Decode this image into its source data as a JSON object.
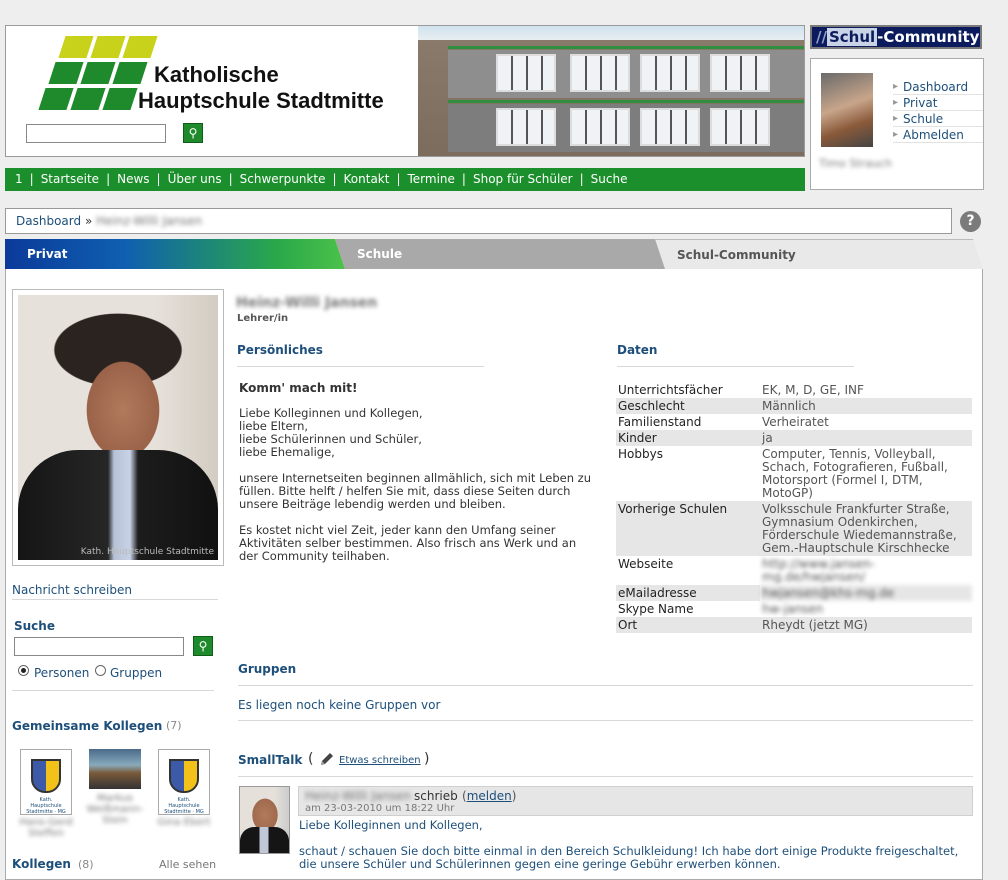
{
  "header": {
    "school_name_line1": "Katholische",
    "school_name_line2": "Hauptschule Stadtmitte",
    "search_placeholder": "",
    "logo_colors": {
      "yellow": "#c9d21a",
      "green": "#1f8a2c"
    }
  },
  "nav": {
    "items": [
      "1",
      "Startseite",
      "News",
      "Über uns",
      "Schwerpunkte",
      "Kontakt",
      "Termine",
      "Shop für Schüler",
      "Suche"
    ]
  },
  "community": {
    "logo_prefix": "//",
    "logo_schul": "Schul",
    "logo_community": "-Community",
    "user_name": "Timo Strauch",
    "menu": [
      "Dashboard",
      "Privat",
      "Schule",
      "Abmelden"
    ]
  },
  "breadcrumb": {
    "root": "Dashboard",
    "separator": "»",
    "current": "Heinz-Willi Jansen"
  },
  "help_icon": "?",
  "tabs": {
    "privat": "Privat",
    "schule": "Schule",
    "community": "Schul-Community"
  },
  "sidebar": {
    "photo_caption": "Kath. Hauptschule Stadtmitte",
    "send_message": "Nachricht schreiben",
    "search_title": "Suche",
    "radio_persons": "Personen",
    "radio_groups": "Gruppen",
    "radio_selected": "Personen",
    "common_title": "Gemeinsame Kollegen",
    "common_count": "(7)",
    "common_people": [
      {
        "name": "Hans-Gerd Steffen",
        "crest_text": "Kath. Hauptschule Stadtmitte · MG"
      },
      {
        "name": "Markus Weißmann-Stein",
        "crest_text": ""
      },
      {
        "name": "Gina Ebert",
        "crest_text": "Kath. Hauptschule Stadtmitte · MG"
      }
    ],
    "colleagues_title": "Kollegen",
    "colleagues_count": "(8)",
    "see_all": "Alle sehen"
  },
  "profile": {
    "name": "Heinz-Willi Jansen",
    "role": "Lehrer/in",
    "personal_title": "Persönliches",
    "intro_heading": "Komm' mach mit!",
    "intro_paragraphs": [
      "Liebe Kolleginnen und Kollegen,\nliebe Eltern,\nliebe Schülerinnen und Schüler,\nliebe Ehemalige,",
      "unsere Internetseiten beginnen allmählich, sich mit Leben zu füllen. Bitte helft / helfen Sie mit, dass diese Seiten durch unsere Beiträge lebendig werden und bleiben.",
      "Es kostet nicht viel Zeit, jeder kann den Umfang seiner Aktivitäten selber bestimmen. Also frisch ans Werk und an der Community teilhaben."
    ]
  },
  "data": {
    "title": "Daten",
    "rows": [
      {
        "key": "Unterrichtsfächer",
        "value": "EK, M, D, GE, INF"
      },
      {
        "key": "Geschlecht",
        "value": "Männlich"
      },
      {
        "key": "Familienstand",
        "value": "Verheiratet"
      },
      {
        "key": "Kinder",
        "value": "ja"
      },
      {
        "key": "Hobbys",
        "value": "Computer, Tennis, Volleyball, Schach, Fotografieren, Fußball, Motorsport (Formel I, DTM, MotoGP)"
      },
      {
        "key": "Vorherige Schulen",
        "value": "Volksschule Frankfurter Straße, Gymnasium Odenkirchen, Förderschule Wiedemannstraße, Gem.-Hauptschule Kirschhecke"
      },
      {
        "key": "Webseite",
        "value": "http://www.jansen-mg.de/hwjansen/",
        "blurred": true
      },
      {
        "key": "eMailadresse",
        "value": "hwjansen@khs-mg.de",
        "blurred": true
      },
      {
        "key": "Skype Name",
        "value": "hw-jansen",
        "blurred": true
      },
      {
        "key": "Ort",
        "value": "Rheydt (jetzt MG)"
      }
    ]
  },
  "groups": {
    "title": "Gruppen",
    "empty": "Es liegen noch keine Gruppen vor"
  },
  "smalltalk": {
    "title": "SmallTalk",
    "paren_open": "(",
    "paren_close": ")",
    "write_link": "Etwas schreiben",
    "post": {
      "author": "Heinz-Willi Jansen",
      "wrote": "schrieb",
      "report_open": "(",
      "report": "melden",
      "report_close": ")",
      "date": "am 23-03-2010 um 18:22 Uhr",
      "greeting": "Liebe Kolleginnen und Kollegen,",
      "body": "schaut / schauen Sie doch bitte einmal in den Bereich Schulkleidung! Ich habe dort einige Produkte freigeschaltet, die unsere Schüler und Schülerinnen gegen eine geringe Gebühr erwerben können."
    }
  }
}
